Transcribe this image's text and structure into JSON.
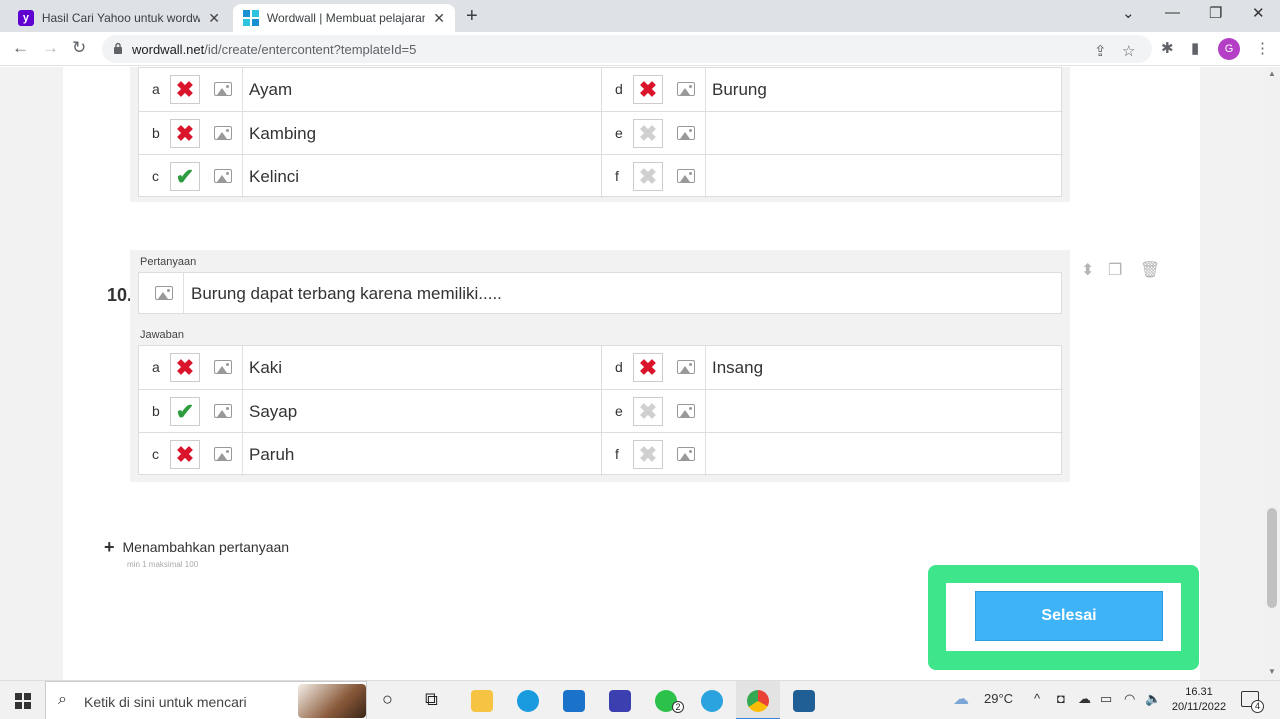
{
  "browser": {
    "tabs": [
      {
        "title": "Hasil Cari Yahoo untuk wordwall"
      },
      {
        "title": "Wordwall | Membuat pelajaran yang"
      }
    ],
    "url_domain": "wordwall.net",
    "url_path": "/id/create/entercontent?templateId=5",
    "avatar_letter": "G"
  },
  "question9": {
    "answers_left": [
      {
        "letter": "a",
        "mark": "wrong",
        "text": "Ayam"
      },
      {
        "letter": "b",
        "mark": "wrong",
        "text": "Kambing"
      },
      {
        "letter": "c",
        "mark": "right",
        "text": "Kelinci"
      }
    ],
    "answers_right": [
      {
        "letter": "d",
        "mark": "wrong",
        "text": "Burung"
      },
      {
        "letter": "e",
        "mark": "empty",
        "text": ""
      },
      {
        "letter": "f",
        "mark": "empty",
        "text": ""
      }
    ]
  },
  "question10": {
    "number": "10.",
    "question_label": "Pertanyaan",
    "question_text": "Burung dapat terbang karena memiliki.....",
    "answers_label": "Jawaban",
    "answers_left": [
      {
        "letter": "a",
        "mark": "wrong",
        "text": "Kaki"
      },
      {
        "letter": "b",
        "mark": "right",
        "text": "Sayap"
      },
      {
        "letter": "c",
        "mark": "wrong",
        "text": "Paruh"
      }
    ],
    "answers_right": [
      {
        "letter": "d",
        "mark": "wrong",
        "text": "Insang"
      },
      {
        "letter": "e",
        "mark": "empty",
        "text": ""
      },
      {
        "letter": "f",
        "mark": "empty",
        "text": ""
      }
    ]
  },
  "add_question": {
    "label": "Menambahkan pertanyaan",
    "hint": "min 1   maksimal 100"
  },
  "done_button": {
    "label": "Selesai"
  },
  "taskbar": {
    "search_placeholder": "Ketik di sini untuk mencari",
    "whatsapp_badge": "2",
    "weather": "29°C",
    "time": "16.31",
    "date": "20/11/2022",
    "notification_count": "4"
  },
  "colors": {
    "wrong": "#d9142b",
    "right": "#2e9c3f",
    "highlight": "#3ee58a",
    "button": "#3fb3f7"
  }
}
